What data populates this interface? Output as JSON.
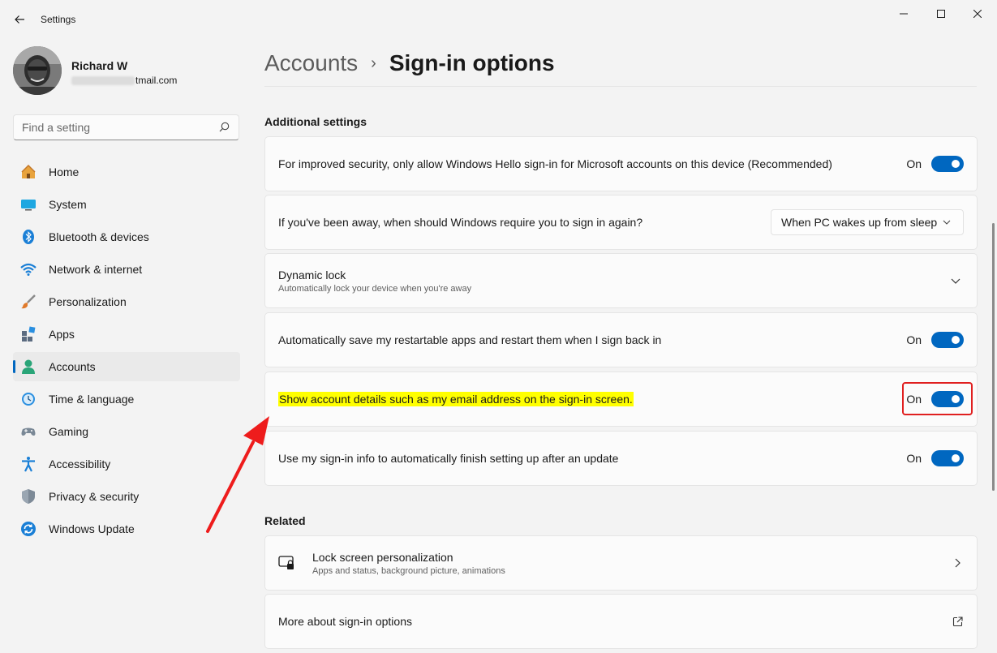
{
  "window": {
    "title": "Settings"
  },
  "profile": {
    "name": "Richard W",
    "email_visible": "tmail.com"
  },
  "search": {
    "placeholder": "Find a setting"
  },
  "sidebar": {
    "items": [
      {
        "label": "Home",
        "icon": "home-icon"
      },
      {
        "label": "System",
        "icon": "system-icon"
      },
      {
        "label": "Bluetooth & devices",
        "icon": "bluetooth-icon"
      },
      {
        "label": "Network & internet",
        "icon": "wifi-icon"
      },
      {
        "label": "Personalization",
        "icon": "brush-icon"
      },
      {
        "label": "Apps",
        "icon": "apps-icon"
      },
      {
        "label": "Accounts",
        "icon": "accounts-icon",
        "active": true
      },
      {
        "label": "Time & language",
        "icon": "clock-icon"
      },
      {
        "label": "Gaming",
        "icon": "gamepad-icon"
      },
      {
        "label": "Accessibility",
        "icon": "accessibility-icon"
      },
      {
        "label": "Privacy & security",
        "icon": "shield-icon"
      },
      {
        "label": "Windows Update",
        "icon": "update-icon"
      }
    ]
  },
  "breadcrumb": {
    "parent": "Accounts",
    "separator": "›",
    "current": "Sign-in options"
  },
  "additional": {
    "title": "Additional settings",
    "hello_only": {
      "text": "For improved security, only allow Windows Hello sign-in for Microsoft accounts on this device (Recommended)",
      "state": "On"
    },
    "away": {
      "text": "If you've been away, when should Windows require you to sign in again?",
      "value": "When PC wakes up from sleep"
    },
    "dynamic_lock": {
      "title": "Dynamic lock",
      "subtitle": "Automatically lock your device when you're away"
    },
    "restart_apps": {
      "text": "Automatically save my restartable apps and restart them when I sign back in",
      "state": "On"
    },
    "account_details": {
      "text": "Show account details such as my email address on the sign-in screen.",
      "state": "On"
    },
    "signin_info": {
      "text": "Use my sign-in info to automatically finish setting up after an update",
      "state": "On"
    }
  },
  "related": {
    "title": "Related",
    "lock_screen": {
      "title": "Lock screen personalization",
      "subtitle": "Apps and status, background picture, animations"
    },
    "more_about": {
      "text": "More about sign-in options"
    }
  },
  "colors": {
    "accent": "#0067c0",
    "highlight": "#ffff00",
    "annotation": "#e02020"
  }
}
